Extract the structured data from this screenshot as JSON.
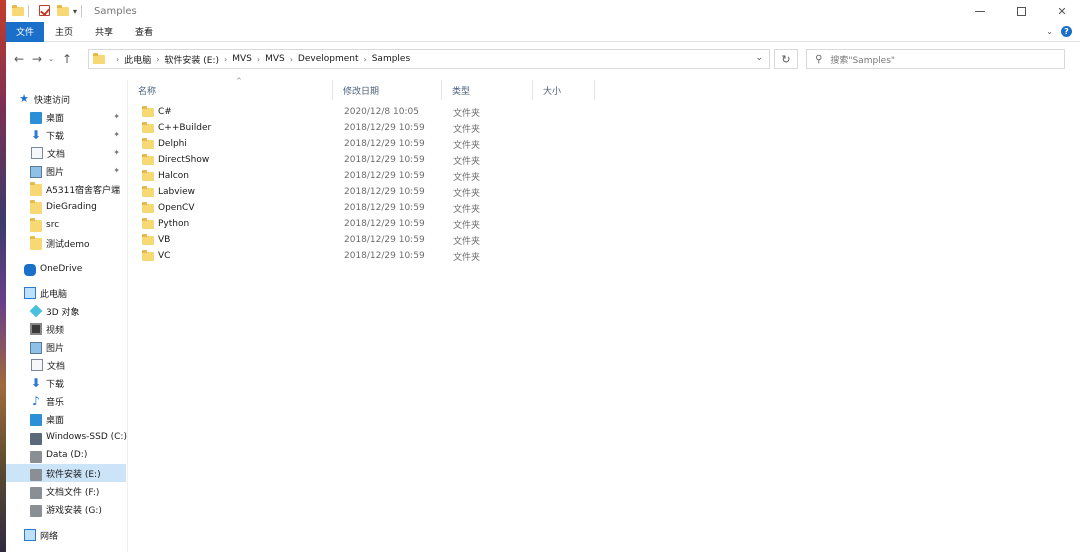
{
  "window": {
    "title": "Samples",
    "qa_dropdown": "▾"
  },
  "controls": {
    "minimize": "—",
    "maximize": "☐",
    "close": "✕"
  },
  "ribbon": {
    "tabs": [
      {
        "label": "文件",
        "active": true
      },
      {
        "label": "主页",
        "active": false
      },
      {
        "label": "共享",
        "active": false
      },
      {
        "label": "查看",
        "active": false
      }
    ],
    "expand": "⌄",
    "help": "?"
  },
  "nav": {
    "back": "←",
    "forward": "→",
    "recent": "⌄",
    "up": "↑",
    "refresh": "↻",
    "address_dropdown": "⌄",
    "breadcrumb": [
      "此电脑",
      "软件安装 (E:)",
      "MVS",
      "MVS",
      "Development",
      "Samples"
    ],
    "crumb_sep": "›"
  },
  "search": {
    "placeholder": "搜索\"Samples\"",
    "icon": "search-icon"
  },
  "sidebar": {
    "quick_access": {
      "label": "快速访问",
      "icon": "star-icon"
    },
    "pinned": [
      {
        "label": "桌面",
        "icon": "desktop-icon",
        "pinned": true
      },
      {
        "label": "下载",
        "icon": "download-icon",
        "pinned": true
      },
      {
        "label": "文档",
        "icon": "document-icon",
        "pinned": true
      },
      {
        "label": "图片",
        "icon": "picture-icon",
        "pinned": true
      },
      {
        "label": "A5311宿舍客户端",
        "icon": "folder-icon",
        "pinned": false
      },
      {
        "label": "DieGrading",
        "icon": "folder-icon",
        "pinned": false
      },
      {
        "label": "src",
        "icon": "folder-icon",
        "pinned": false
      },
      {
        "label": "测试demo",
        "icon": "folder-icon",
        "pinned": false
      }
    ],
    "onedrive": {
      "label": "OneDrive",
      "icon": "cloud-icon"
    },
    "this_pc": {
      "label": "此电脑",
      "icon": "computer-icon"
    },
    "pc_items": [
      {
        "label": "3D 对象",
        "icon": "3d-objects-icon"
      },
      {
        "label": "视频",
        "icon": "video-icon"
      },
      {
        "label": "图片",
        "icon": "picture-icon"
      },
      {
        "label": "文档",
        "icon": "document-icon"
      },
      {
        "label": "下载",
        "icon": "download-icon"
      },
      {
        "label": "音乐",
        "icon": "music-icon"
      },
      {
        "label": "桌面",
        "icon": "desktop-icon"
      },
      {
        "label": "Windows-SSD (C:)",
        "icon": "system-drive-icon"
      },
      {
        "label": "Data (D:)",
        "icon": "drive-icon"
      },
      {
        "label": "软件安装 (E:)",
        "icon": "drive-icon",
        "selected": true
      },
      {
        "label": "文档文件 (F:)",
        "icon": "drive-icon"
      },
      {
        "label": "游戏安装 (G:)",
        "icon": "drive-icon"
      }
    ],
    "network": {
      "label": "网络",
      "icon": "network-icon"
    },
    "pin_glyph": "📌",
    "expand_glyph": "›"
  },
  "filelist": {
    "columns": {
      "name": "名称",
      "date": "修改日期",
      "type": "类型",
      "size": "大小"
    },
    "sort_arrow": "^",
    "rows": [
      {
        "name": "C#",
        "date": "2020/12/8 10:05",
        "type": "文件夹"
      },
      {
        "name": "C++Builder",
        "date": "2018/12/29 10:59",
        "type": "文件夹"
      },
      {
        "name": "Delphi",
        "date": "2018/12/29 10:59",
        "type": "文件夹"
      },
      {
        "name": "DirectShow",
        "date": "2018/12/29 10:59",
        "type": "文件夹"
      },
      {
        "name": "Halcon",
        "date": "2018/12/29 10:59",
        "type": "文件夹"
      },
      {
        "name": "Labview",
        "date": "2018/12/29 10:59",
        "type": "文件夹"
      },
      {
        "name": "OpenCV",
        "date": "2018/12/29 10:59",
        "type": "文件夹"
      },
      {
        "name": "Python",
        "date": "2018/12/29 10:59",
        "type": "文件夹"
      },
      {
        "name": "VB",
        "date": "2018/12/29 10:59",
        "type": "文件夹"
      },
      {
        "name": "VC",
        "date": "2018/12/29 10:59",
        "type": "文件夹"
      }
    ]
  }
}
